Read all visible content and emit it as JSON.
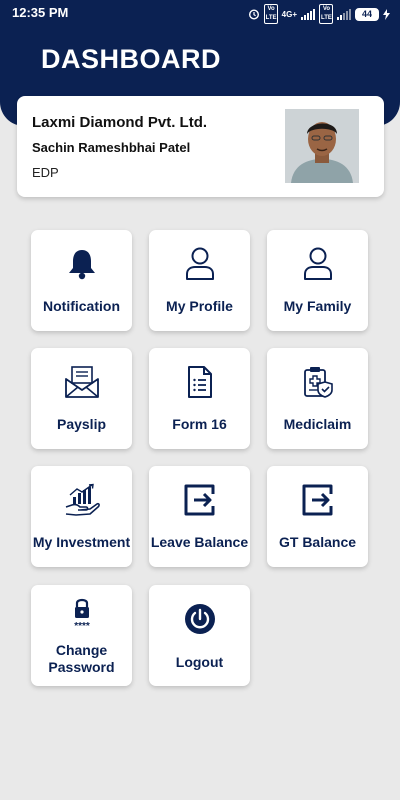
{
  "status": {
    "time": "12:35 PM",
    "net": "4G+",
    "volte1": "Vo LTE",
    "volte2": "Vo LTE",
    "battery": "44"
  },
  "header": {
    "title": "DASHBOARD"
  },
  "profile": {
    "company": "Laxmi Diamond Pvt. Ltd.",
    "name": "Sachin Rameshbhai Patel",
    "department": "EDP"
  },
  "tiles": [
    {
      "label": "Notification",
      "icon": "bell-icon"
    },
    {
      "label": "My Profile",
      "icon": "user-icon"
    },
    {
      "label": "My Family",
      "icon": "user-icon"
    },
    {
      "label": "Payslip",
      "icon": "envelope-icon"
    },
    {
      "label": "Form 16",
      "icon": "document-icon"
    },
    {
      "label": "Mediclaim",
      "icon": "medical-clipboard-icon"
    },
    {
      "label": "My Investment",
      "icon": "investment-hand-icon"
    },
    {
      "label": "Leave Balance",
      "icon": "exit-arrow-icon"
    },
    {
      "label": "GT Balance",
      "icon": "exit-arrow-icon"
    },
    {
      "label_line1": "Change",
      "label_line2": "Password",
      "icon": "lock-password-icon"
    },
    {
      "label": "Logout",
      "icon": "power-icon"
    }
  ],
  "colors": {
    "navy": "#0b2152",
    "background": "#e9e9e9",
    "card": "#ffffff"
  }
}
